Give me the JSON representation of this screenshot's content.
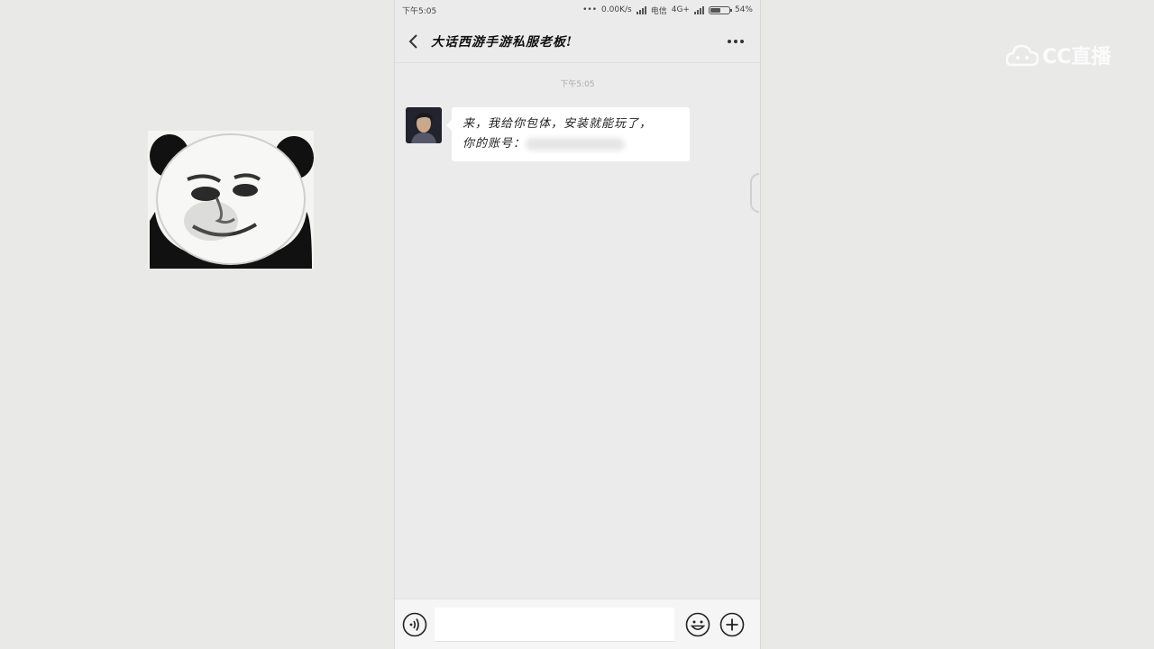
{
  "status_bar": {
    "time": "下午5:05",
    "net_speed": "0.00K/s",
    "carrier": "电信",
    "network": "4G+",
    "battery": "54%",
    "battery_level": 0.54
  },
  "chat": {
    "title": "大话西游手游私服老板!",
    "timestamp": "下午5:05",
    "message_line1": "来，我给你包体，安装就能玩了，",
    "message_line2": "你的账号："
  },
  "watermark": {
    "text": "CC直播"
  },
  "icons": {
    "back": "chevron-left-icon",
    "more": "more-dots-icon",
    "voice": "voice-icon",
    "emoji": "emoji-icon",
    "plus": "plus-icon"
  }
}
